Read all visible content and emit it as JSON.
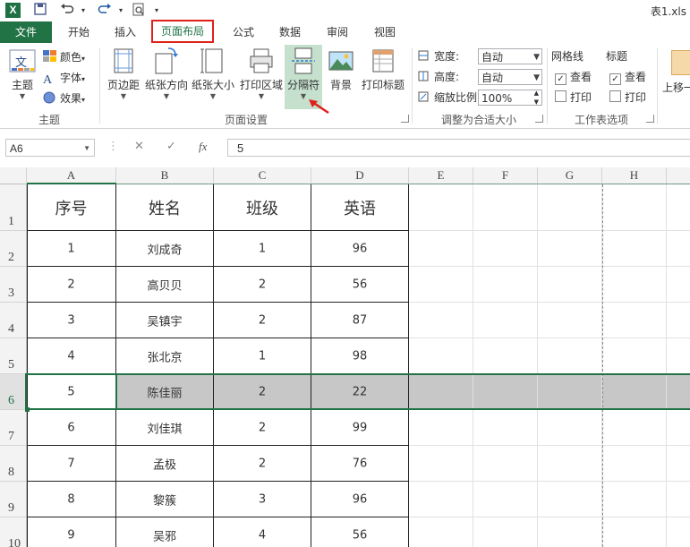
{
  "app": {
    "logo_letter": "X",
    "doc_title": "表1.xls"
  },
  "quick_access": {
    "save_icon": "save-icon",
    "undo_icon": "undo-icon",
    "redo_icon": "redo-icon",
    "preview_icon": "print-preview-icon"
  },
  "tabs": [
    {
      "label": "文件"
    },
    {
      "label": "开始"
    },
    {
      "label": "插入"
    },
    {
      "label": "页面布局"
    },
    {
      "label": "公式"
    },
    {
      "label": "数据"
    },
    {
      "label": "审阅"
    },
    {
      "label": "视图"
    }
  ],
  "ribbon": {
    "themes": {
      "theme_label": "主题",
      "colors_label": "颜色",
      "fonts_label": "字体",
      "effects_label": "效果",
      "group_label": "主题"
    },
    "page_setup": {
      "margins": "页边距",
      "orientation": "纸张方向",
      "size": "纸张大小",
      "print_area": "打印区域",
      "breaks": "分隔符",
      "background": "背景",
      "print_titles": "打印标题",
      "group_label": "页面设置"
    },
    "scale": {
      "width_label": "宽度:",
      "width_value": "自动",
      "height_label": "高度:",
      "height_value": "自动",
      "scale_label": "缩放比例:",
      "scale_value": "100%",
      "group_label": "调整为合适大小"
    },
    "sheet_options": {
      "gridlines": "网格线",
      "headings": "标题",
      "view": "查看",
      "print": "打印",
      "group_label": "工作表选项"
    },
    "arrange": {
      "bring_forward": "上移一"
    }
  },
  "formula_bar": {
    "name_box": "A6",
    "cancel_icon": "✕",
    "enter_icon": "✓",
    "fx": "fx",
    "value": "5"
  },
  "columns": [
    "A",
    "B",
    "C",
    "D",
    "E",
    "F",
    "G",
    "H"
  ],
  "rows": [
    "1",
    "2",
    "3",
    "4",
    "5",
    "6",
    "7",
    "8",
    "9",
    "10"
  ],
  "table": {
    "headers": [
      "序号",
      "姓名",
      "班级",
      "英语"
    ],
    "rows": [
      [
        "1",
        "刘成奇",
        "1",
        "96"
      ],
      [
        "2",
        "高贝贝",
        "2",
        "56"
      ],
      [
        "3",
        "吴镇宇",
        "2",
        "87"
      ],
      [
        "4",
        "张北京",
        "1",
        "98"
      ],
      [
        "5",
        "陈佳丽",
        "2",
        "22"
      ],
      [
        "6",
        "刘佳琪",
        "2",
        "99"
      ],
      [
        "7",
        "孟极",
        "2",
        "76"
      ],
      [
        "8",
        "黎簇",
        "3",
        "96"
      ],
      [
        "9",
        "吴邪",
        "4",
        "56"
      ]
    ],
    "selected_row": "6"
  },
  "colors": {
    "excel_green": "#217346",
    "highlight_red": "#e0201a",
    "selection_gray": "#c8c7c8"
  }
}
